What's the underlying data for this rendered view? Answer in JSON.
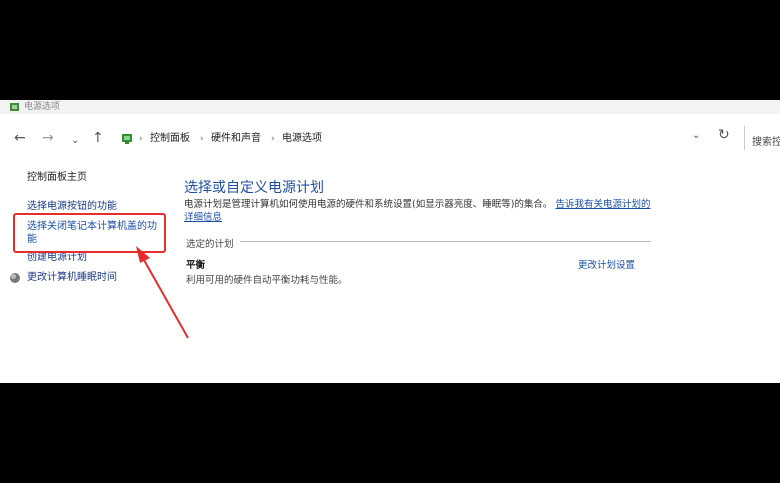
{
  "window": {
    "title": "电源选项"
  },
  "nav": {
    "back": "←",
    "forward": "→",
    "recent": "⌄",
    "up": "↑",
    "breadcrumbs": [
      "控制面板",
      "硬件和声音",
      "电源选项"
    ],
    "separator": "›",
    "dropdown": "⌄",
    "refresh": "↻",
    "search_placeholder": "搜索控"
  },
  "sidebar": {
    "home": "控制面板主页",
    "power_buttons": "选择电源按钮的功能",
    "lid": "选择关闭笔记本计算机盖的功能",
    "create": "创建电源计划",
    "sleep": "更改计算机睡眠时间"
  },
  "main": {
    "title": "选择或自定义电源计划",
    "description": "电源计划是管理计算机如何使用电源的硬件和系统设置(如显示器亮度、睡眠等)的集合。",
    "description_link": "告诉我有关电源计划的详细信息",
    "plans_label": "选定的计划",
    "plan_name": "平衡",
    "plan_description": "利用可用的硬件自动平衡功耗与性能。",
    "plan_link": "更改计划设置"
  },
  "colors": {
    "highlight": "#e52d2d",
    "link": "#1a4fa8"
  }
}
